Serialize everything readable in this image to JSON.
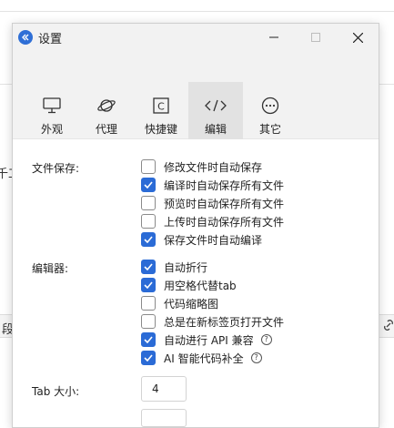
{
  "background": {
    "text_left_1": "千工",
    "text_left_2": "段"
  },
  "window": {
    "title": "设置",
    "icons": {
      "app": "app-logo-icon",
      "minimize": "minimize-icon",
      "maximize": "maximize-icon",
      "close": "close-icon"
    }
  },
  "tabs": [
    {
      "label": "外观",
      "icon": "monitor-icon"
    },
    {
      "label": "代理",
      "icon": "planet-icon"
    },
    {
      "label": "快捷键",
      "icon": "key-c-icon"
    },
    {
      "label": "编辑",
      "icon": "code-icon"
    },
    {
      "label": "其它",
      "icon": "more-icon"
    }
  ],
  "active_tab": "编辑",
  "file_save": {
    "label": "文件保存:",
    "options": [
      {
        "label": "修改文件时自动保存",
        "checked": false
      },
      {
        "label": "编译时自动保存所有文件",
        "checked": true
      },
      {
        "label": "预览时自动保存所有文件",
        "checked": false
      },
      {
        "label": "上传时自动保存所有文件",
        "checked": false
      },
      {
        "label": "保存文件时自动编译",
        "checked": true
      }
    ]
  },
  "editor": {
    "label": "编辑器:",
    "options": [
      {
        "label": "自动折行",
        "checked": true
      },
      {
        "label": "用空格代替tab",
        "checked": true
      },
      {
        "label": "代码缩略图",
        "checked": false
      },
      {
        "label": "总是在新标签页打开文件",
        "checked": false
      },
      {
        "label": "自动进行 API 兼容",
        "checked": true,
        "help": "?"
      },
      {
        "label": "AI 智能代码补全",
        "checked": true,
        "help": "?"
      }
    ]
  },
  "tab_size": {
    "label": "Tab 大小:",
    "value": "4"
  },
  "colors": {
    "accent": "#2b6bd6",
    "titlebar": "#f2f2f2",
    "active_tab": "#e2e2e2"
  }
}
